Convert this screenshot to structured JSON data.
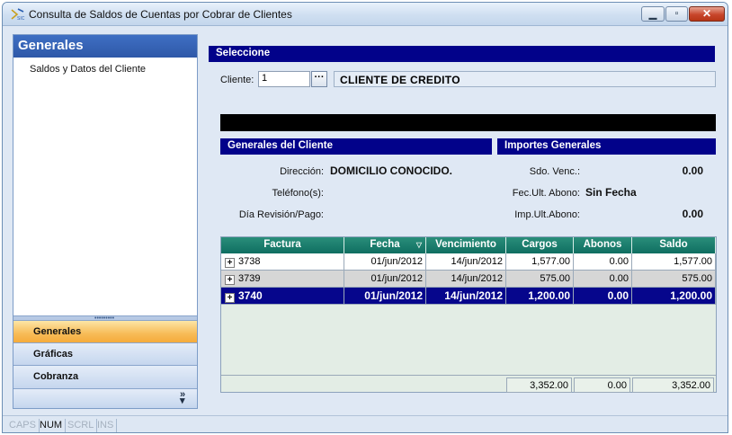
{
  "window": {
    "title": "Consulta de Saldos de Cuentas por Cobrar de Clientes"
  },
  "left_panel": {
    "header": "Generales",
    "item": "Saldos y Datos del Cliente",
    "nav": [
      {
        "label": "Generales",
        "active": true
      },
      {
        "label": "Gráficas",
        "active": false
      },
      {
        "label": "Cobranza",
        "active": false
      }
    ]
  },
  "statusbar": {
    "items": [
      {
        "label": "CAPS",
        "on": false
      },
      {
        "label": "NUM",
        "on": true
      },
      {
        "label": "SCRL",
        "on": false
      },
      {
        "label": "INS",
        "on": false
      }
    ]
  },
  "seleccione": {
    "header": "Seleccione",
    "cliente_label": "Cliente:",
    "cliente_value": "1",
    "cliente_name": "CLIENTE DE CREDITO"
  },
  "generales_cliente": {
    "header": "Generales del Cliente",
    "direccion_label": "Dirección:",
    "direccion_value": "DOMICILIO CONOCIDO.",
    "telefono_label": "Teléfono(s):",
    "telefono_value": "",
    "dia_label": "Día Revisión/Pago:",
    "dia_value": ""
  },
  "importes": {
    "header": "Importes Generales",
    "sdo_label": "Sdo. Venc.:",
    "sdo_value": "0.00",
    "fec_label": "Fec.Ult. Abono:",
    "fec_value": "Sin Fecha",
    "imp_label": "Imp.Ult.Abono:",
    "imp_value": "0.00"
  },
  "grid": {
    "columns": [
      "Factura",
      "Fecha",
      "Vencimiento",
      "Cargos",
      "Abonos",
      "Saldo"
    ],
    "rows": [
      {
        "factura": "3738",
        "fecha": "01/jun/2012",
        "vencimiento": "14/jun/2012",
        "cargos": "1,577.00",
        "abonos": "0.00",
        "saldo": "1,577.00"
      },
      {
        "factura": "3739",
        "fecha": "01/jun/2012",
        "vencimiento": "14/jun/2012",
        "cargos": "575.00",
        "abonos": "0.00",
        "saldo": "575.00"
      },
      {
        "factura": "3740",
        "fecha": "01/jun/2012",
        "vencimiento": "14/jun/2012",
        "cargos": "1,200.00",
        "abonos": "0.00",
        "saldo": "1,200.00"
      }
    ],
    "selected_row": 2,
    "totals": {
      "cargos": "3,352.00",
      "abonos": "0.00",
      "saldo": "3,352.00"
    }
  },
  "colors": {
    "section_header": "#02028a",
    "grid_header": "#0f6e61",
    "selected_row": "#06068c",
    "active_nav": "#f7bb57"
  }
}
